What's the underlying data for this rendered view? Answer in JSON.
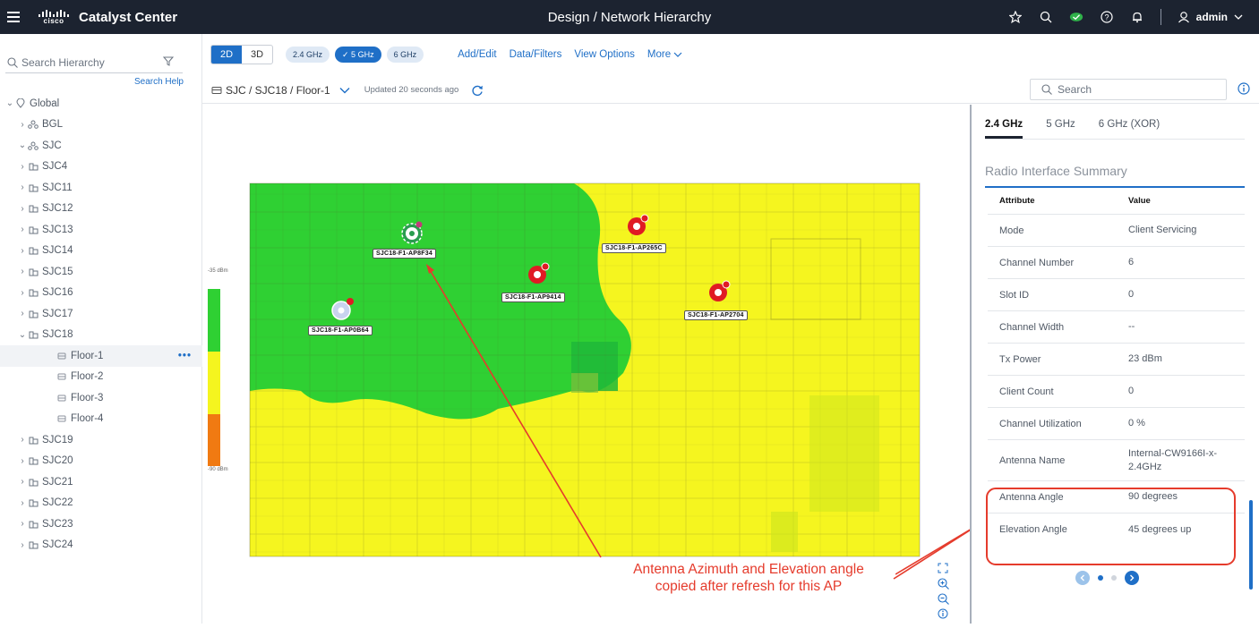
{
  "app": {
    "title": "Catalyst Center",
    "breadcrumb": "Design  /  Network Hierarchy",
    "user": "admin",
    "logo_text": "cisco"
  },
  "hierarchy": {
    "search_placeholder": "Search Hierarchy",
    "search_help": "Search Help",
    "items": [
      {
        "label": "Global",
        "level": 0,
        "caret": "⌄",
        "icon": "location-pin-icon"
      },
      {
        "label": "BGL",
        "level": 1,
        "caret": "›",
        "icon": "area-icon"
      },
      {
        "label": "SJC",
        "level": 1,
        "caret": "⌄",
        "icon": "area-icon"
      },
      {
        "label": "SJC4",
        "level": 2,
        "caret": "›",
        "icon": "building-icon"
      },
      {
        "label": "SJC11",
        "level": 2,
        "caret": "›",
        "icon": "building-icon"
      },
      {
        "label": "SJC12",
        "level": 2,
        "caret": "›",
        "icon": "building-icon"
      },
      {
        "label": "SJC13",
        "level": 2,
        "caret": "›",
        "icon": "building-icon"
      },
      {
        "label": "SJC14",
        "level": 2,
        "caret": "›",
        "icon": "building-icon"
      },
      {
        "label": "SJC15",
        "level": 2,
        "caret": "›",
        "icon": "building-icon"
      },
      {
        "label": "SJC16",
        "level": 2,
        "caret": "›",
        "icon": "building-icon"
      },
      {
        "label": "SJC17",
        "level": 2,
        "caret": "›",
        "icon": "building-icon"
      },
      {
        "label": "SJC18",
        "level": 2,
        "caret": "⌄",
        "icon": "building-icon"
      },
      {
        "label": "Floor-1",
        "level": 3,
        "caret": "",
        "icon": "floor-icon",
        "selected": true,
        "more": "•••"
      },
      {
        "label": "Floor-2",
        "level": 3,
        "caret": "",
        "icon": "floor-icon"
      },
      {
        "label": "Floor-3",
        "level": 3,
        "caret": "",
        "icon": "floor-icon"
      },
      {
        "label": "Floor-4",
        "level": 3,
        "caret": "",
        "icon": "floor-icon"
      },
      {
        "label": "SJC19",
        "level": 2,
        "caret": "›",
        "icon": "building-icon"
      },
      {
        "label": "SJC20",
        "level": 2,
        "caret": "›",
        "icon": "building-icon"
      },
      {
        "label": "SJC21",
        "level": 2,
        "caret": "›",
        "icon": "building-icon"
      },
      {
        "label": "SJC22",
        "level": 2,
        "caret": "›",
        "icon": "building-icon"
      },
      {
        "label": "SJC23",
        "level": 2,
        "caret": "›",
        "icon": "building-icon"
      },
      {
        "label": "SJC24",
        "level": 2,
        "caret": "›",
        "icon": "building-icon"
      }
    ]
  },
  "toolbar": {
    "view_2d": "2D",
    "view_3d": "3D",
    "band_24": "2.4 GHz",
    "band_5": "✓ 5 GHz",
    "band_6": "6 GHz",
    "add_edit": "Add/Edit",
    "data_filters": "Data/Filters",
    "view_options": "View Options",
    "more": "More"
  },
  "location": {
    "path": "SJC / SJC18 / Floor-1",
    "updated": "Updated 20 seconds ago",
    "search_placeholder": "Search"
  },
  "map": {
    "legend_top": "-35 dBm",
    "legend_bottom": "-90 dBm",
    "colors": {
      "strong": "#2fd033",
      "medium": "#f5f51f",
      "weak": "#f07a12"
    },
    "aps": [
      {
        "name": "SJC18-F1-AP8F34",
        "status": "selected"
      },
      {
        "name": "SJC18-F1-AP265C",
        "status": "alert"
      },
      {
        "name": "SJC18-F1-AP9414",
        "status": "alert"
      },
      {
        "name": "SJC18-F1-AP2704",
        "status": "alert"
      },
      {
        "name": "SJC18-F1-AP0B64",
        "status": "unassigned"
      }
    ],
    "annotation_line1": "Antenna Azimuth and Elevation angle",
    "annotation_line2": "copied after refresh for this AP"
  },
  "panel": {
    "tabs": [
      "2.4 GHz",
      "5 GHz",
      "6 GHz (XOR)"
    ],
    "title": "Radio Interface Summary",
    "col_attr": "Attribute",
    "col_value": "Value",
    "rows": [
      {
        "attr": "Mode",
        "value": "Client Servicing"
      },
      {
        "attr": "Channel Number",
        "value": "6"
      },
      {
        "attr": "Slot ID",
        "value": "0"
      },
      {
        "attr": "Channel Width",
        "value": "--"
      },
      {
        "attr": "Tx Power",
        "value": "23 dBm"
      },
      {
        "attr": "Client Count",
        "value": "0"
      },
      {
        "attr": "Channel Utilization",
        "value": "0 %"
      },
      {
        "attr": "Antenna Name",
        "value": "Internal-CW9166I-x-2.4GHz"
      },
      {
        "attr": "Antenna Angle",
        "value": "90 degrees"
      },
      {
        "attr": "Elevation Angle",
        "value": "45 degrees up"
      }
    ],
    "accent": "#1f6fc7",
    "highlight_color": "#e53b2c"
  }
}
